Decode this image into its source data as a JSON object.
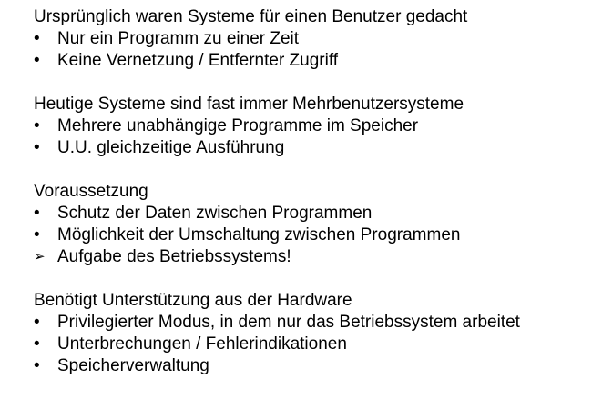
{
  "sections": [
    {
      "heading": "Ursprünglich waren Systeme für einen Benutzer gedacht",
      "items": [
        {
          "marker": "•",
          "text": "Nur ein Programm zu einer Zeit"
        },
        {
          "marker": "•",
          "text": "Keine Vernetzung / Entfernter Zugriff"
        }
      ]
    },
    {
      "heading": "Heutige Systeme sind fast immer Mehrbenutzersysteme",
      "items": [
        {
          "marker": "•",
          "text": "Mehrere unabhängige Programme im Speicher"
        },
        {
          "marker": "•",
          "text": "U.U. gleichzeitige Ausführung"
        }
      ]
    },
    {
      "heading": "Voraussetzung",
      "items": [
        {
          "marker": "•",
          "text": "Schutz der Daten zwischen Programmen"
        },
        {
          "marker": "•",
          "text": "Möglichkeit der Umschaltung zwischen Programmen"
        },
        {
          "marker": "➢",
          "text": "Aufgabe des Betriebssystems!"
        }
      ]
    },
    {
      "heading": "Benötigt Unterstützung aus der Hardware",
      "items": [
        {
          "marker": "•",
          "text": "Privilegierter Modus, in dem nur das Betriebssystem arbeitet"
        },
        {
          "marker": "•",
          "text": "Unterbrechungen / Fehlerindikationen"
        },
        {
          "marker": "•",
          "text": "Speicherverwaltung"
        }
      ]
    }
  ]
}
